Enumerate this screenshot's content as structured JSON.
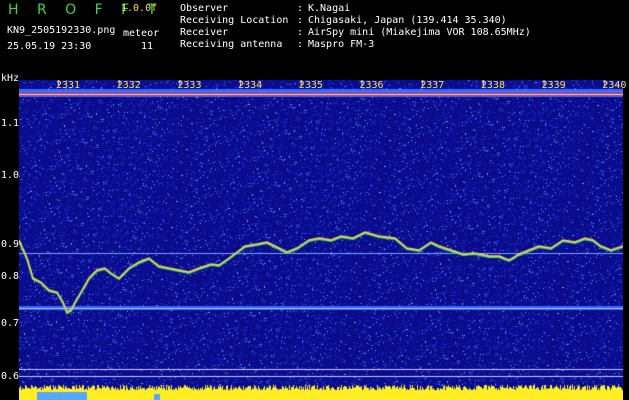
{
  "app": {
    "title": "H R O F F T",
    "version": "1.0.0f"
  },
  "file": {
    "name": "KN9_2505192330.png",
    "datetime": "25.05.19 23:30"
  },
  "meteor": {
    "label": "meteor",
    "count": "11"
  },
  "info": [
    {
      "label": "Observer",
      "value": "K.Nagai"
    },
    {
      "label": "Receiving Location",
      "value": "Chigasaki, Japan (139.414 35.340)"
    },
    {
      "label": "Receiver",
      "value": "AirSpy mini (Miakejima VOR 108.65MHz)"
    },
    {
      "label": "Receiving antenna",
      "value": "Maspro FM-3"
    }
  ],
  "axis": {
    "unit": "kHz",
    "y_ticks": [
      "1.1",
      "1.0",
      "0.9",
      "0.8",
      "0.7",
      "0.6"
    ],
    "time_ticks": [
      "2331",
      "2332",
      "2333",
      "2334",
      "2335",
      "2336",
      "2337",
      "2338",
      "2339",
      "2340"
    ]
  },
  "colors": {
    "background": "#0a0f8c",
    "trace": "#ffd23a",
    "title": "#39d54b"
  }
}
